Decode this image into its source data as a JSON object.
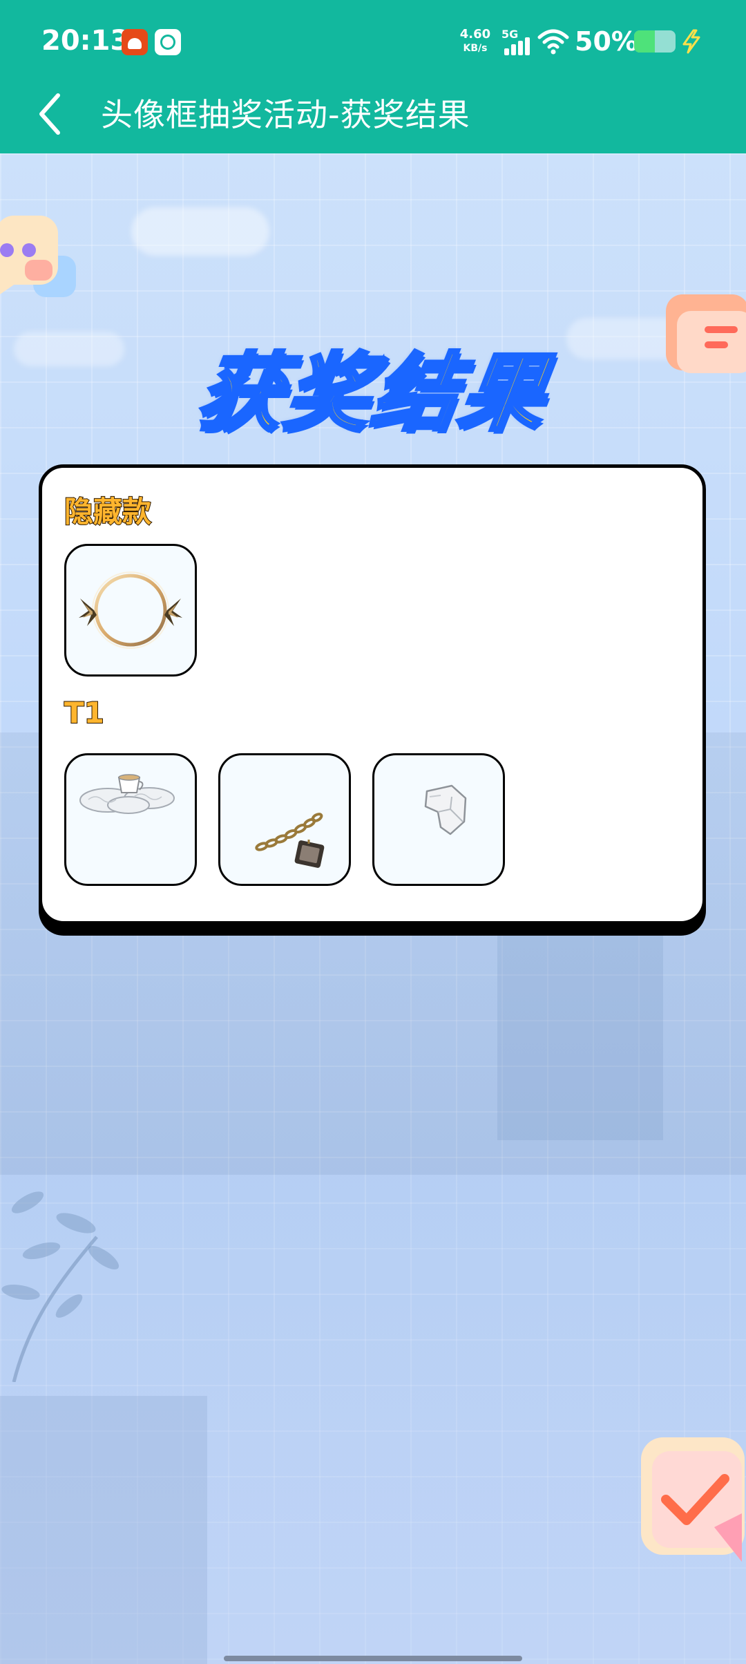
{
  "status_bar": {
    "time": "20:13",
    "network_speed_value": "4.60",
    "network_speed_unit": "KB/s",
    "network_type": "5G",
    "battery_percent": "50%",
    "battery_level": 0.5
  },
  "nav": {
    "title": "头像框抽奖活动-获奖结果"
  },
  "heading": "获奖结果",
  "tiers": [
    {
      "label": "隐藏款",
      "prizes": [
        "golden-ring-wings-frame-icon"
      ]
    },
    {
      "label": "T1",
      "prizes": [
        "cloud-teacup-frame-icon",
        "chain-pendant-frame-icon",
        "white-rock-frame-icon"
      ]
    }
  ],
  "colors": {
    "header": "#12b89e",
    "heading_fill": "#ffd21f",
    "heading_outline": "#1a66ff",
    "tier_label": "#ffb52e"
  }
}
